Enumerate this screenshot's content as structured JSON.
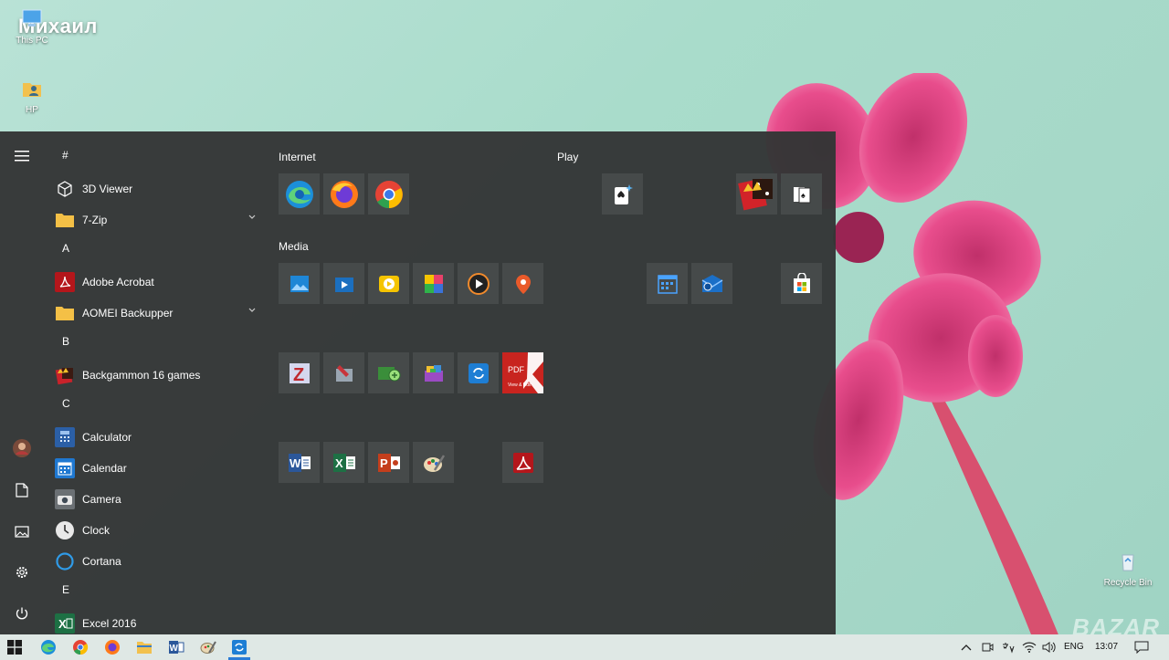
{
  "desktop": {
    "overlay_name": "Михаил",
    "icons": [
      {
        "label": "This PC"
      },
      {
        "label": "HP"
      },
      {
        "label": "Recycle Bin"
      }
    ],
    "watermark": "BAZAR"
  },
  "start_menu": {
    "app_list": [
      {
        "type": "header",
        "label": "#"
      },
      {
        "type": "app",
        "label": "3D Viewer",
        "icon": "cube-icon"
      },
      {
        "type": "app",
        "label": "7-Zip",
        "icon": "folder-icon",
        "expandable": true
      },
      {
        "type": "header",
        "label": "A"
      },
      {
        "type": "app",
        "label": "Adobe Acrobat",
        "icon": "acrobat-icon"
      },
      {
        "type": "app",
        "label": "AOMEI Backupper",
        "icon": "folder-icon",
        "expandable": true
      },
      {
        "type": "header",
        "label": "B"
      },
      {
        "type": "app",
        "label": "Backgammon 16 games",
        "icon": "backgammon-icon"
      },
      {
        "type": "header",
        "label": "C"
      },
      {
        "type": "app",
        "label": "Calculator",
        "icon": "calculator-icon"
      },
      {
        "type": "app",
        "label": "Calendar",
        "icon": "calendar-icon"
      },
      {
        "type": "app",
        "label": "Camera",
        "icon": "camera-icon"
      },
      {
        "type": "app",
        "label": "Clock",
        "icon": "clock-icon"
      },
      {
        "type": "app",
        "label": "Cortana",
        "icon": "cortana-icon"
      },
      {
        "type": "header",
        "label": "E"
      },
      {
        "type": "app",
        "label": "Excel 2016",
        "icon": "excel-icon"
      }
    ],
    "groups": {
      "internet": "Internet",
      "media": "Media",
      "play": "Play"
    },
    "tiles": {
      "internet": [
        "edge-icon",
        "firefox-icon",
        "chrome-icon"
      ],
      "media": [
        "photos-icon",
        "movies-icon",
        "media-player-icon",
        "paint-icon",
        "groove-icon",
        "maps-icon"
      ],
      "row3": [
        "zip-icon",
        "disk-tool-icon",
        "network-tool-icon",
        "archive-tool-icon",
        "sync-icon",
        "pdf-editor-icon"
      ],
      "row4": [
        "word-icon",
        "excel-icon",
        "powerpoint-icon",
        "paint-brush-icon",
        "acrobat-icon"
      ],
      "play": [
        "solitaire-icon",
        "backgammon-icon",
        "cards-icon"
      ],
      "play2": [
        "calendar-icon",
        "mail-icon",
        "store-icon"
      ],
      "pdf_tile_text": "PDF",
      "pdf_tile_sub": "View & Edit"
    }
  },
  "taskbar": {
    "apps": [
      "edge-icon",
      "chrome-icon",
      "firefox-icon",
      "file-explorer-icon",
      "word-icon",
      "paint-brush-icon",
      "sync-icon"
    ],
    "language": "ENG",
    "time": "13:07"
  },
  "colors": {
    "start_bg": "#343636",
    "tile_bg": "#484c4c",
    "accent": "#2a7bd6"
  }
}
